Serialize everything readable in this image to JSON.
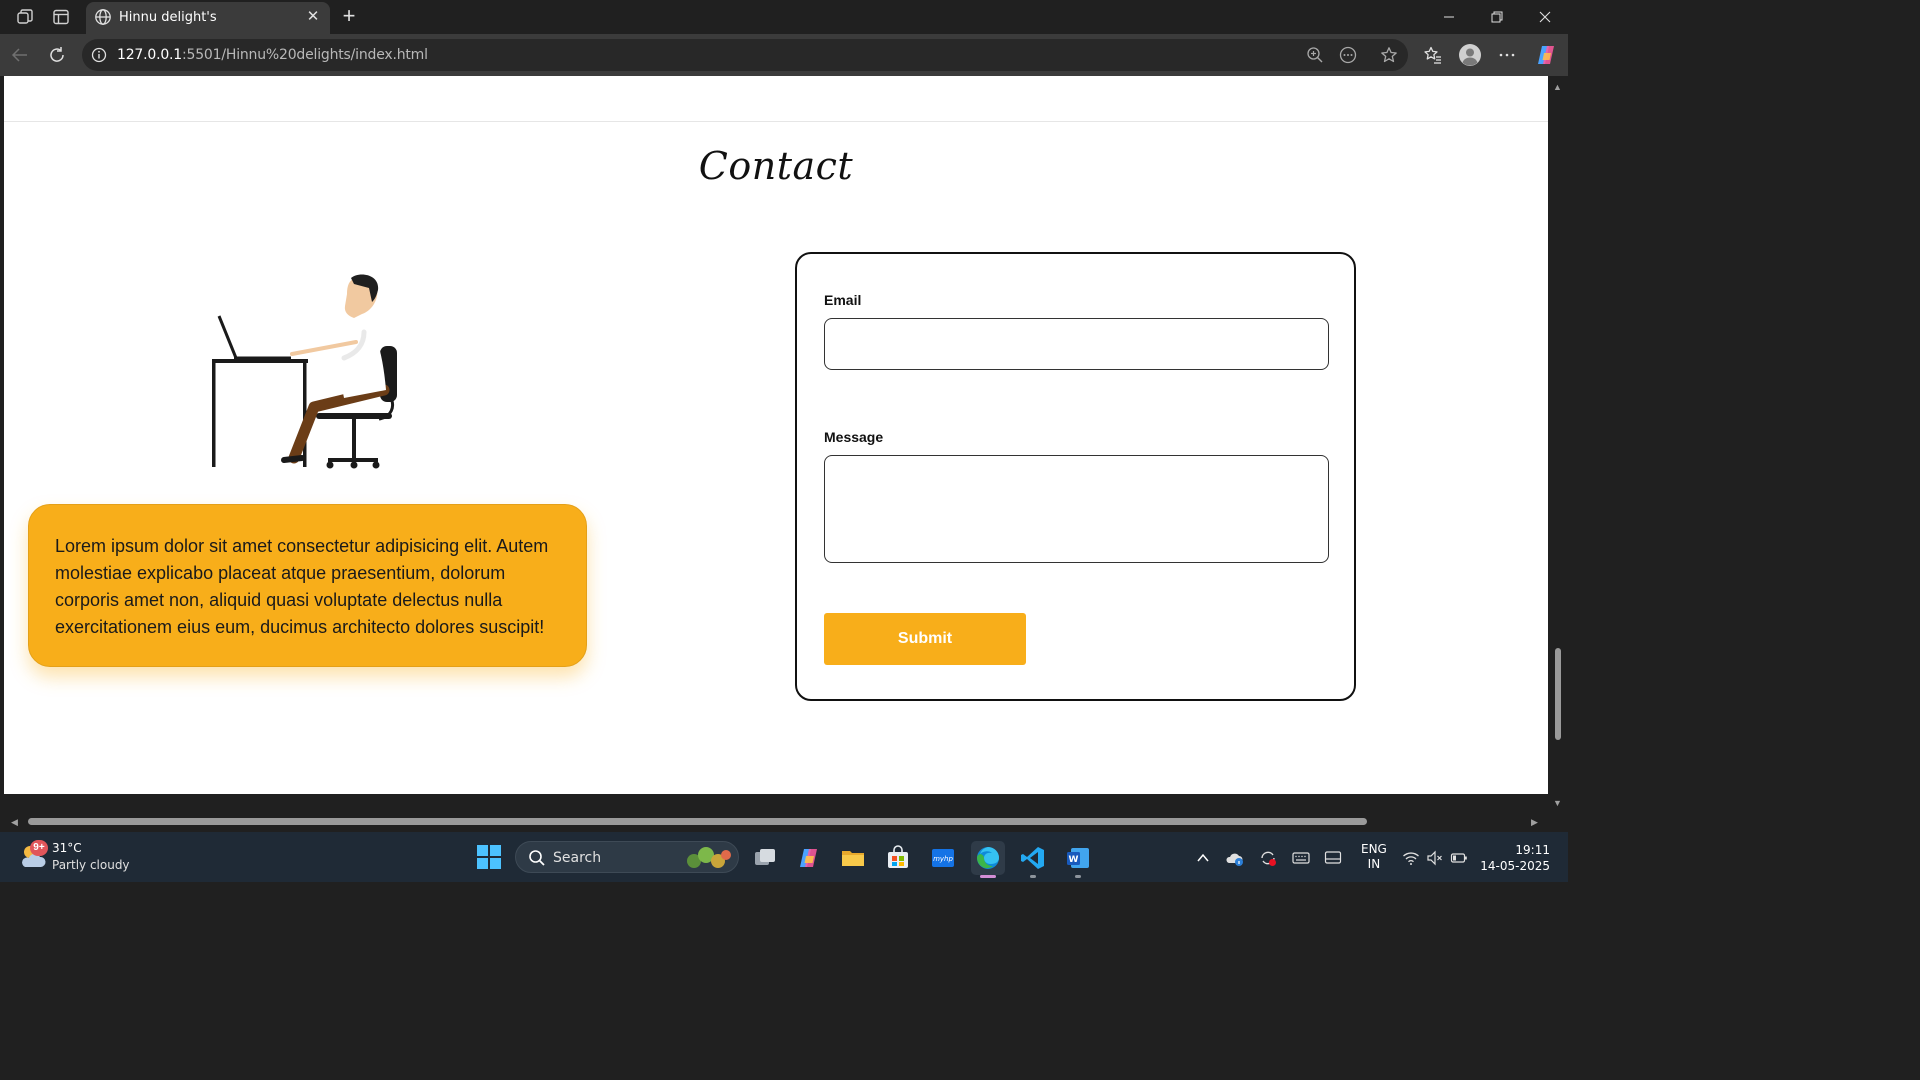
{
  "browser": {
    "tab_title": "Hinnu delight's",
    "url_host": "127.0.0.1",
    "url_rest": ":5501/Hinnu%20delights/index.html"
  },
  "page": {
    "heading": "Contact",
    "info_text": "Lorem ipsum dolor sit amet consectetur adipisicing elit. Autem molestiae explicabo placeat atque praesentium, dolorum corporis amet non, aliquid quasi voluptate delectus nulla exercitationem eius eum, ducimus architecto dolores suscipit!",
    "accent_color": "#f8ae1a",
    "form": {
      "email_label": "Email",
      "email_value": "",
      "message_label": "Message",
      "message_value": "",
      "submit_label": "Submit"
    }
  },
  "taskbar": {
    "weather_badge": "9+",
    "temperature": "31°C",
    "condition": "Partly cloudy",
    "search_label": "Search",
    "language_line1": "ENG",
    "language_line2": "IN",
    "time": "19:11",
    "date": "14-05-2025"
  }
}
